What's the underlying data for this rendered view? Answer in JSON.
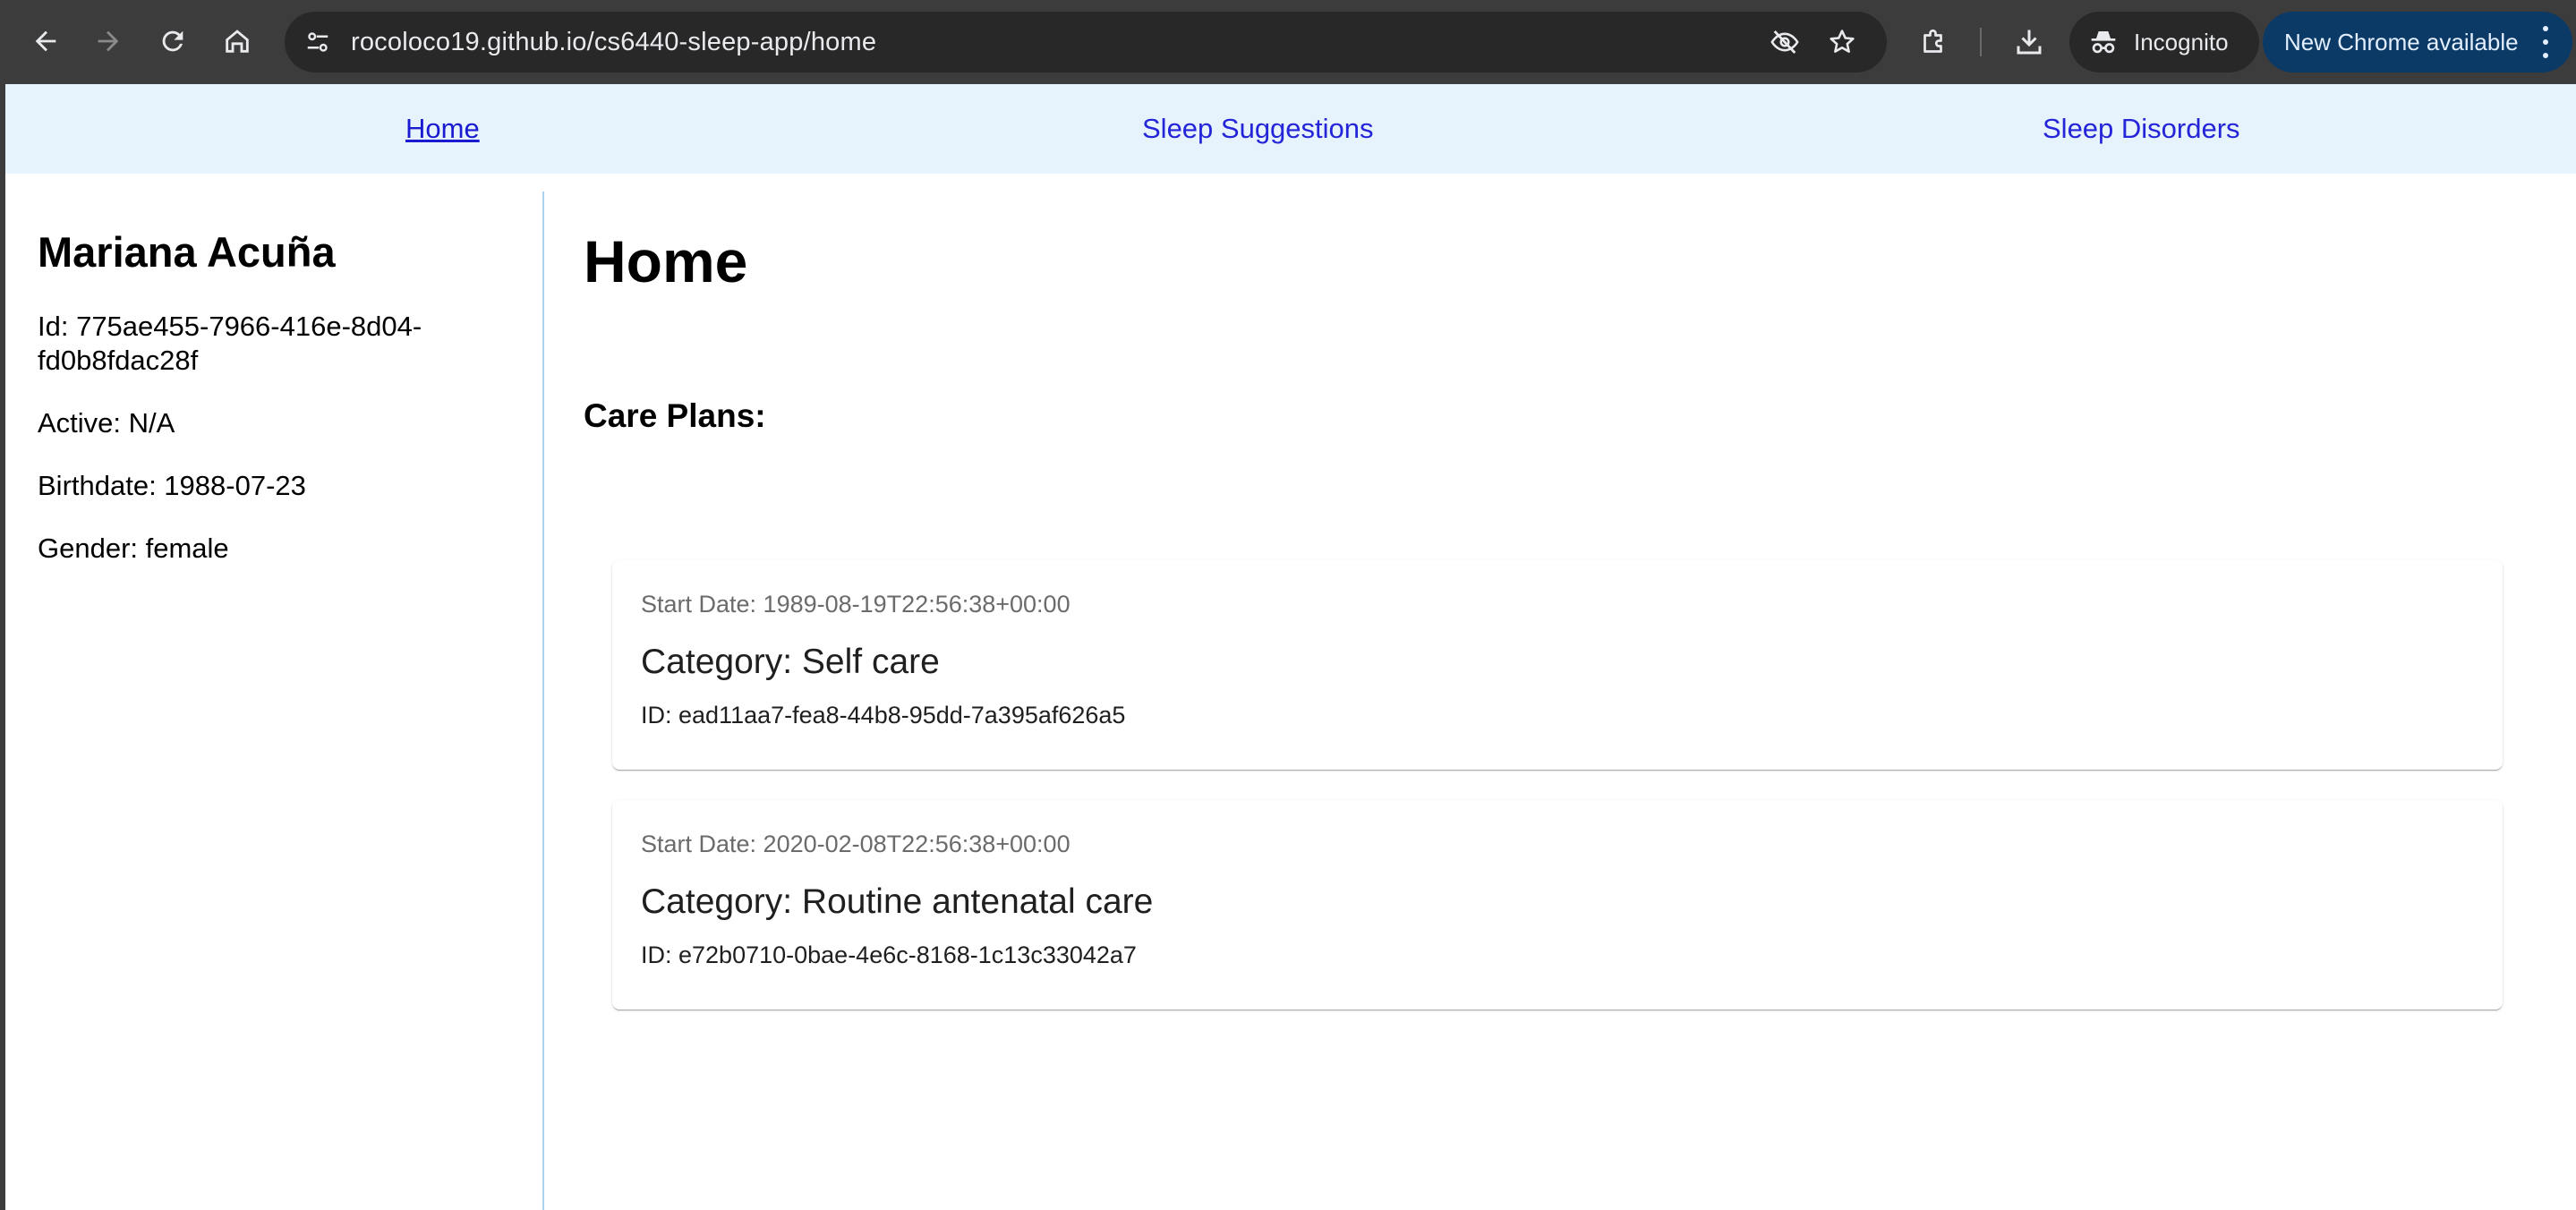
{
  "browser": {
    "url": "rocoloco19.github.io/cs6440-sleep-app/home",
    "incognito_label": "Incognito",
    "update_label": "New Chrome available"
  },
  "nav": {
    "home": "Home",
    "suggestions": "Sleep Suggestions",
    "disorders": "Sleep Disorders"
  },
  "patient": {
    "name": "Mariana Acuña",
    "id": "Id: 775ae455-7966-416e-8d04-fd0b8fdac28f",
    "active": "Active: N/A",
    "birthdate": "Birthdate: 1988-07-23",
    "gender": "Gender: female"
  },
  "main": {
    "title": "Home",
    "care_plans_heading": "Care Plans:",
    "care_plans": [
      {
        "start_date": "Start Date: 1989-08-19T22:56:38+00:00",
        "category": "Category: Self care",
        "id": "ID: ead11aa7-fea8-44b8-95dd-7a395af626a5"
      },
      {
        "start_date": "Start Date: 2020-02-08T22:56:38+00:00",
        "category": "Category: Routine antenatal care",
        "id": "ID: e72b0710-0bae-4e6c-8168-1c13c33042a7"
      }
    ]
  },
  "icons": {
    "back": "arrow-left-icon",
    "forward": "arrow-right-icon",
    "reload": "reload-icon",
    "home": "home-icon",
    "site_info": "tune-icon",
    "eye_off": "eye-off-icon",
    "bookmark": "star-icon",
    "extensions": "puzzle-icon",
    "download": "download-icon",
    "incognito": "incognito-icon",
    "menu": "kebab-menu-icon"
  },
  "colors": {
    "chrome_bg": "#3c3c3c",
    "nav_bg": "#e6f2fc",
    "link": "#2424d8",
    "sidebar_border": "#a9d2ef",
    "update_pill": "#0b3a66"
  }
}
